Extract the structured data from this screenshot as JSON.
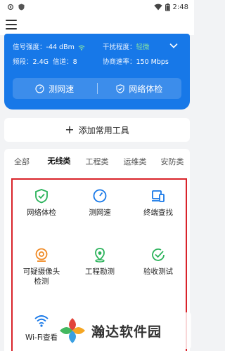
{
  "status_bar": {
    "time": "2:48",
    "icons": [
      "settings-icon",
      "shield-icon",
      "wifi-signal-icon",
      "battery-icon"
    ]
  },
  "top_bar": {
    "icon": "menu-icon"
  },
  "wifi_card": {
    "signal_label": "信号强度：",
    "signal_value": "-44 dBm",
    "interference_label": "干扰程度：",
    "interference_value": "轻微",
    "band_label": "频段：",
    "band_value": "2.4G",
    "channel_label": "信道：",
    "channel_value": "8",
    "rate_label": "协商速率：",
    "rate_value": "150 Mbps",
    "speed_test_label": "测网速",
    "health_check_label": "网络体检",
    "colors": {
      "card": "#1778e8",
      "mild": "#86e3a3"
    }
  },
  "add_tool": {
    "label": "添加常用工具"
  },
  "tabs": [
    {
      "label": "全部",
      "active": false
    },
    {
      "label": "无线类",
      "active": true
    },
    {
      "label": "工程类",
      "active": false
    },
    {
      "label": "运维类",
      "active": false
    },
    {
      "label": "安防类",
      "active": false
    }
  ],
  "tools": [
    {
      "label": "网络体检",
      "icon": "shield-check-icon",
      "color": "#2ab25a"
    },
    {
      "label": "测网速",
      "icon": "speedometer-icon",
      "color": "#1778e8"
    },
    {
      "label": "终端查找",
      "icon": "devices-icon",
      "color": "#1778e8"
    },
    {
      "label": "可疑摄像头检测",
      "label_line1": "可疑摄像头",
      "label_line2": "检测",
      "icon": "camera-search-icon",
      "color": "#f08a24"
    },
    {
      "label": "工程勘测",
      "icon": "location-pin-icon",
      "color": "#2ab25a"
    },
    {
      "label": "验收测试",
      "icon": "check-circle-icon",
      "color": "#2ab25a"
    },
    {
      "label": "Wi-Fi查看",
      "icon": "wifi-icon",
      "color": "#1778e8"
    }
  ],
  "watermark": {
    "text": "瀚达软件园"
  }
}
